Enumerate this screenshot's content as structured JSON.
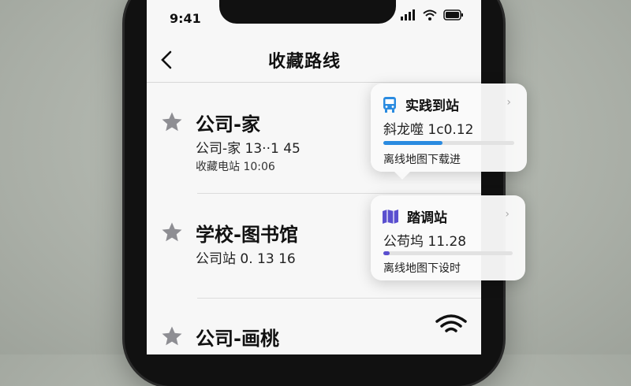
{
  "status_bar": {
    "time": "9:41"
  },
  "header": {
    "back_label": "‹",
    "title": "收藏路线"
  },
  "routes": [
    {
      "title": "公司-家",
      "subtitle": "公司-家  13··1 45",
      "meta": "收藏电站 10:06"
    },
    {
      "title": "学校-图书馆",
      "subtitle": "公司站  0. 13 16"
    },
    {
      "title": "公司-画桃"
    }
  ],
  "cards": [
    {
      "title": "实践到站",
      "chevron": "›",
      "body": "斜龙噬  1c0.12",
      "progress": 0.45,
      "progress_color": "#2a8be0",
      "footer": "离线地图下载进",
      "icon": "bus-icon"
    },
    {
      "title": "踏调站",
      "chevron": "›",
      "body": "公苟坞  11.28",
      "progress": 0.05,
      "progress_color": "#5a4fcf",
      "footer": "离线地图下设时",
      "icon": "map-icon"
    }
  ],
  "colors": {
    "accent_blue": "#2a8be0",
    "accent_purple": "#5a4fcf",
    "star_gray": "#8e8e93"
  }
}
